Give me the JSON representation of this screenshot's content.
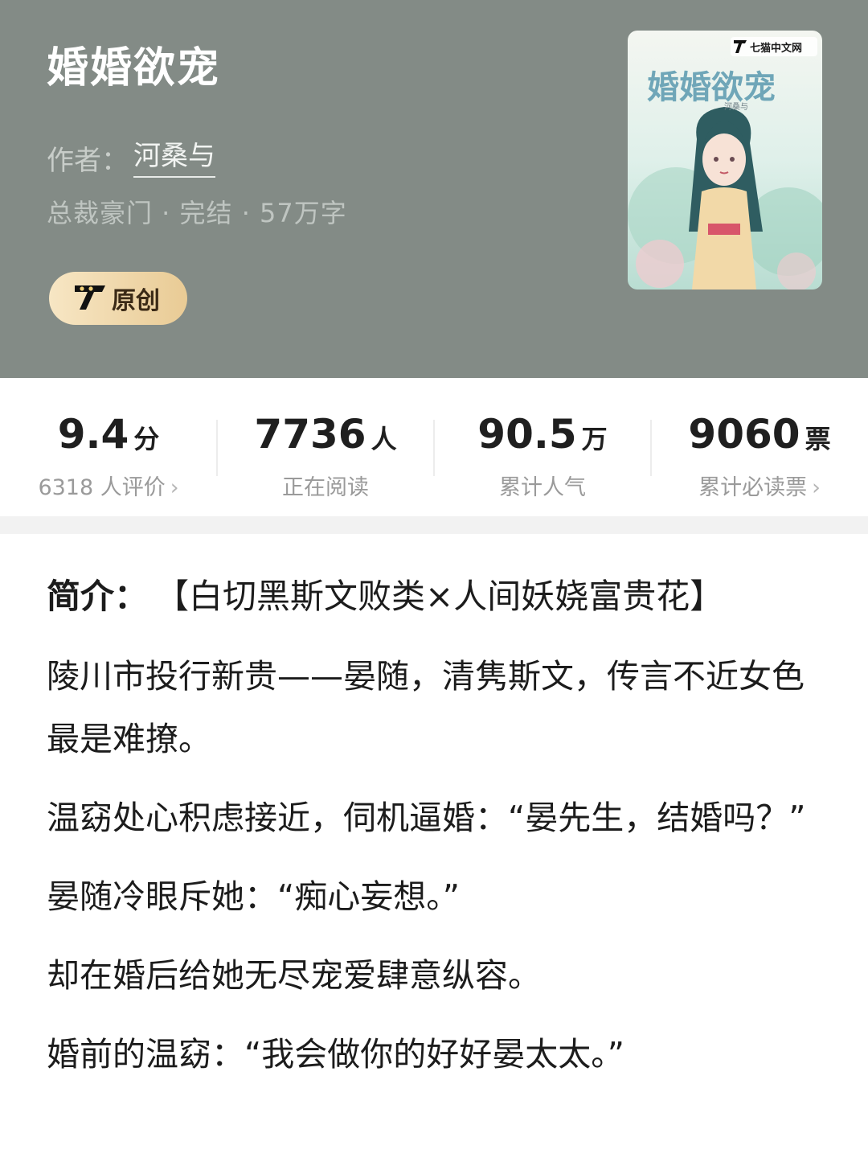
{
  "book": {
    "title": "婚婚欲宠",
    "author_label": "作者：",
    "author": "河桑与",
    "meta": "总裁豪门 · 完结 · 57万字",
    "badge": "原创"
  },
  "cover": {
    "brand": "七猫中文网",
    "title": "婚婚欲宠",
    "author_small": "河桑与"
  },
  "stats": [
    {
      "value": "9.4",
      "unit": "分",
      "label": "6318 人评价",
      "chevron": "›"
    },
    {
      "value": "7736",
      "unit": "人",
      "label": "正在阅读",
      "chevron": ""
    },
    {
      "value": "90.5",
      "unit": "万",
      "label": "累计人气",
      "chevron": ""
    },
    {
      "value": "9060",
      "unit": "票",
      "label": "累计必读票",
      "chevron": "›"
    }
  ],
  "intro": {
    "label": "简介：",
    "tagline": "【白切黑斯文败类×人间妖娆富贵花】",
    "paragraphs": [
      "陵川市投行新贵——晏随，清隽斯文，传言不近女色最是难撩。",
      "温窈处心积虑接近，伺机逼婚：“晏先生，结婚吗？”",
      "晏随冷眼斥她：“痴心妄想。”",
      "却在婚后给她无尽宠爱肆意纵容。",
      "婚前的温窈：“我会做你的好好晏太太。”"
    ]
  },
  "colors": {
    "header_bg": "#838b86",
    "badge_gold": "#e9cb95"
  }
}
